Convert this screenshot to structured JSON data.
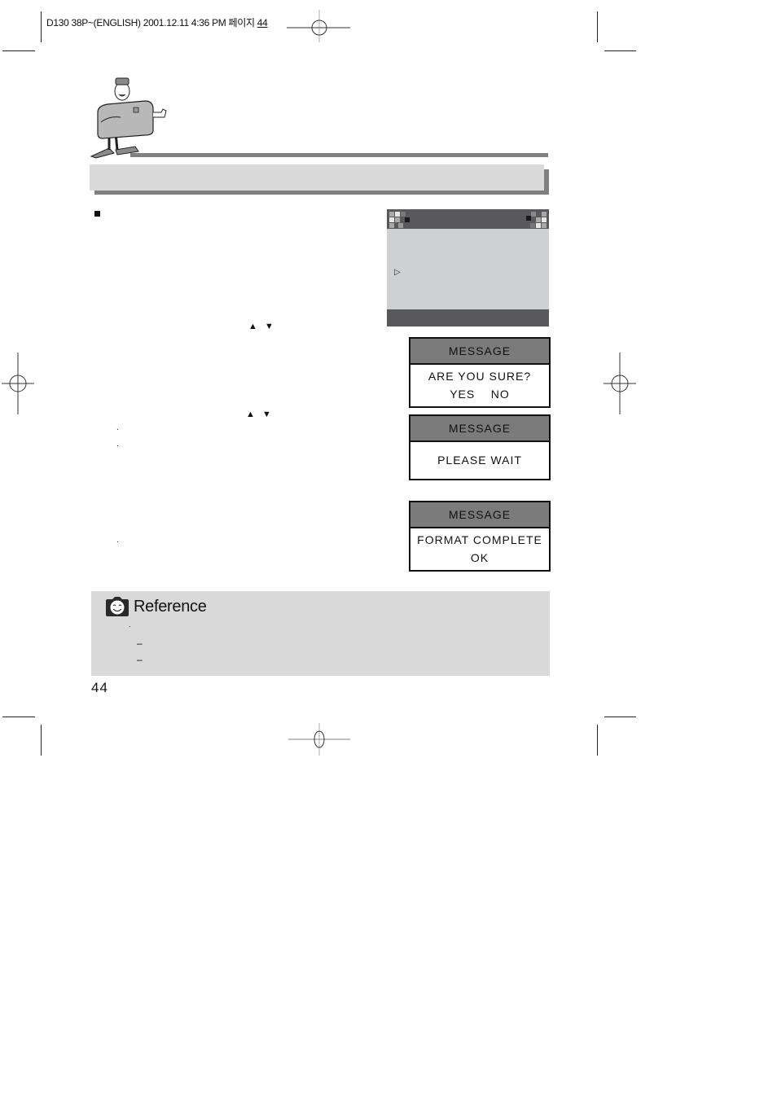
{
  "print_slug": {
    "text": "D130 38P~(ENGLISH)  2001.12.11  4:36 PM 페이지 ",
    "page_ref": "44"
  },
  "section_title": "",
  "instructions": {
    "bullet_icon": "black-square",
    "nav_arrows_1": "▲ ▼",
    "nav_arrows_2": "▲ ▼",
    "list_dots": [
      ".",
      ".",
      "."
    ]
  },
  "lcd_menu": {
    "pointer": "▷",
    "colors": {
      "frame": "#59595b",
      "body": "#cfd0d2"
    }
  },
  "messages": [
    {
      "header": "MESSAGE",
      "lines": [
        "ARE YOU SURE?",
        "YES    NO"
      ]
    },
    {
      "header": "MESSAGE",
      "lines": [
        "PLEASE WAIT"
      ]
    },
    {
      "header": "MESSAGE",
      "lines": [
        "FORMAT COMPLETE",
        "OK"
      ]
    }
  ],
  "reference": {
    "title": "Reference",
    "icon": "smiling-camera-icon",
    "bullet": ".",
    "dashes": [
      "–",
      "–"
    ]
  },
  "page_number": "44",
  "colors": {
    "header_rule": "#808080",
    "title_bar": "#dadada",
    "message_header": "#7b7b7b",
    "reference_bg": "#d9d9d9"
  }
}
